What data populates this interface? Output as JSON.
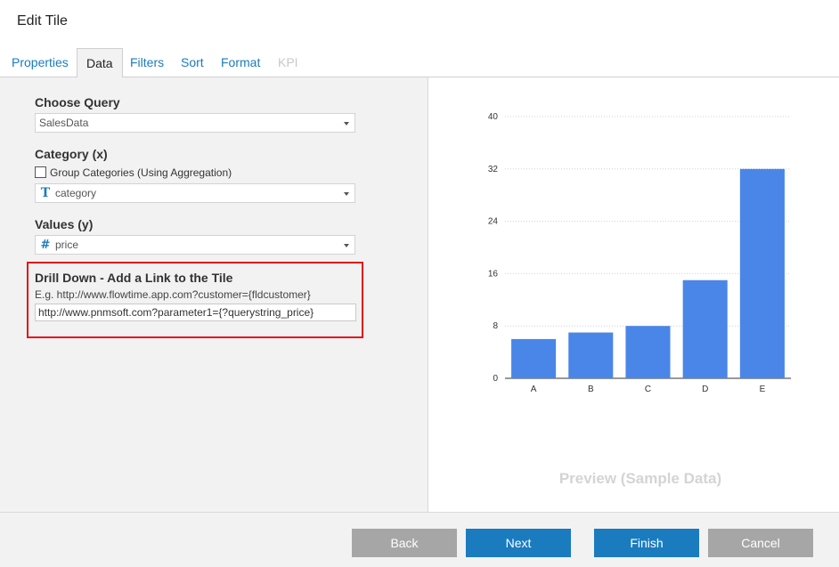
{
  "window": {
    "title": "Edit Tile"
  },
  "tabs": [
    {
      "label": "Properties",
      "state": "normal"
    },
    {
      "label": "Data",
      "state": "active"
    },
    {
      "label": "Filters",
      "state": "normal"
    },
    {
      "label": "Sort",
      "state": "normal"
    },
    {
      "label": "Format",
      "state": "normal"
    },
    {
      "label": "KPI",
      "state": "disabled"
    }
  ],
  "form": {
    "query": {
      "label": "Choose Query",
      "value": "SalesData"
    },
    "category": {
      "label": "Category (x)",
      "checkbox_label": "Group Categories (Using Aggregation)",
      "checked": false,
      "icon": "text-type-icon",
      "value": "category"
    },
    "values": {
      "label": "Values (y)",
      "icon": "number-type-icon",
      "value": "price"
    },
    "drill_down": {
      "label": "Drill Down - Add a Link to the Tile",
      "example": "E.g. http://www.flowtime.app.com?customer={fldcustomer}",
      "value": "http://www.pnmsoft.com?parameter1={?querystring_price}"
    }
  },
  "preview": {
    "label": "Preview (Sample Data)"
  },
  "chart_data": {
    "type": "bar",
    "categories": [
      "A",
      "B",
      "C",
      "D",
      "E"
    ],
    "values": [
      6,
      7,
      8,
      15,
      32
    ],
    "ylim": [
      0,
      40
    ],
    "yticks": [
      "0",
      "8",
      "16",
      "24",
      "32",
      "40"
    ],
    "bar_color": "#4a86e8",
    "grid": true
  },
  "footer": {
    "back_label": "Back",
    "next_label": "Next",
    "finish_label": "Finish",
    "cancel_label": "Cancel"
  },
  "colors": {
    "accent": "#1a7bbf",
    "highlight": "#e3141b",
    "disabled_button": "#a6a6a6"
  }
}
